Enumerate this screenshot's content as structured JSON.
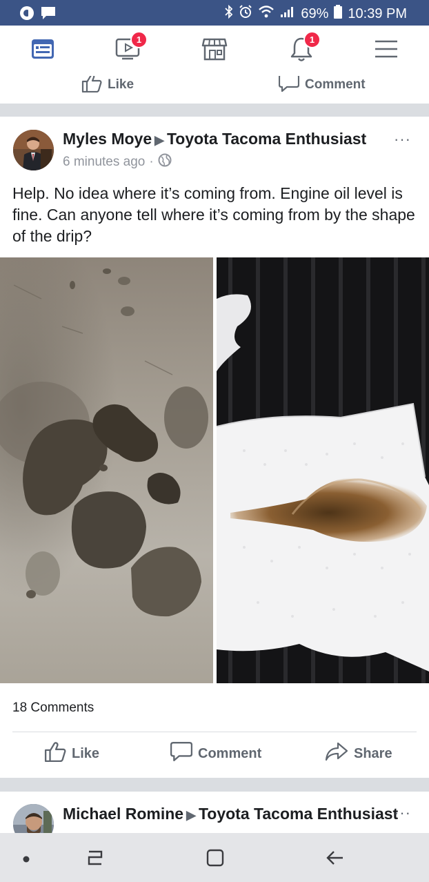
{
  "status": {
    "battery": "69%",
    "time": "10:39 PM"
  },
  "nav": {
    "icons": [
      "news-feed-icon",
      "watch-icon",
      "marketplace-icon",
      "notifications-icon",
      "menu-icon"
    ],
    "watch_badge": "1",
    "notifications_badge": "1"
  },
  "prev_post": {
    "like_label": "Like",
    "comment_label": "Comment"
  },
  "post": {
    "author": "Myles Moye",
    "group": "Toyota Tacoma Enthusiast",
    "time": "6 minutes ago",
    "separator": "·",
    "more": "···",
    "text": "Help. No idea where it’s coming from. Engine oil level is fine. Can anyone tell where it’s coming from by the shape of the drip?",
    "comments_count": "18 Comments",
    "actions": {
      "like": "Like",
      "comment": "Comment",
      "share": "Share"
    }
  },
  "next_post": {
    "author": "Michael Romine",
    "group": "Toyota Tacoma Enthusiast",
    "more": "···"
  },
  "colors": {
    "status_bar": "#3b5486",
    "brand_blue": "#4267b2",
    "badge_red": "#f02849"
  }
}
